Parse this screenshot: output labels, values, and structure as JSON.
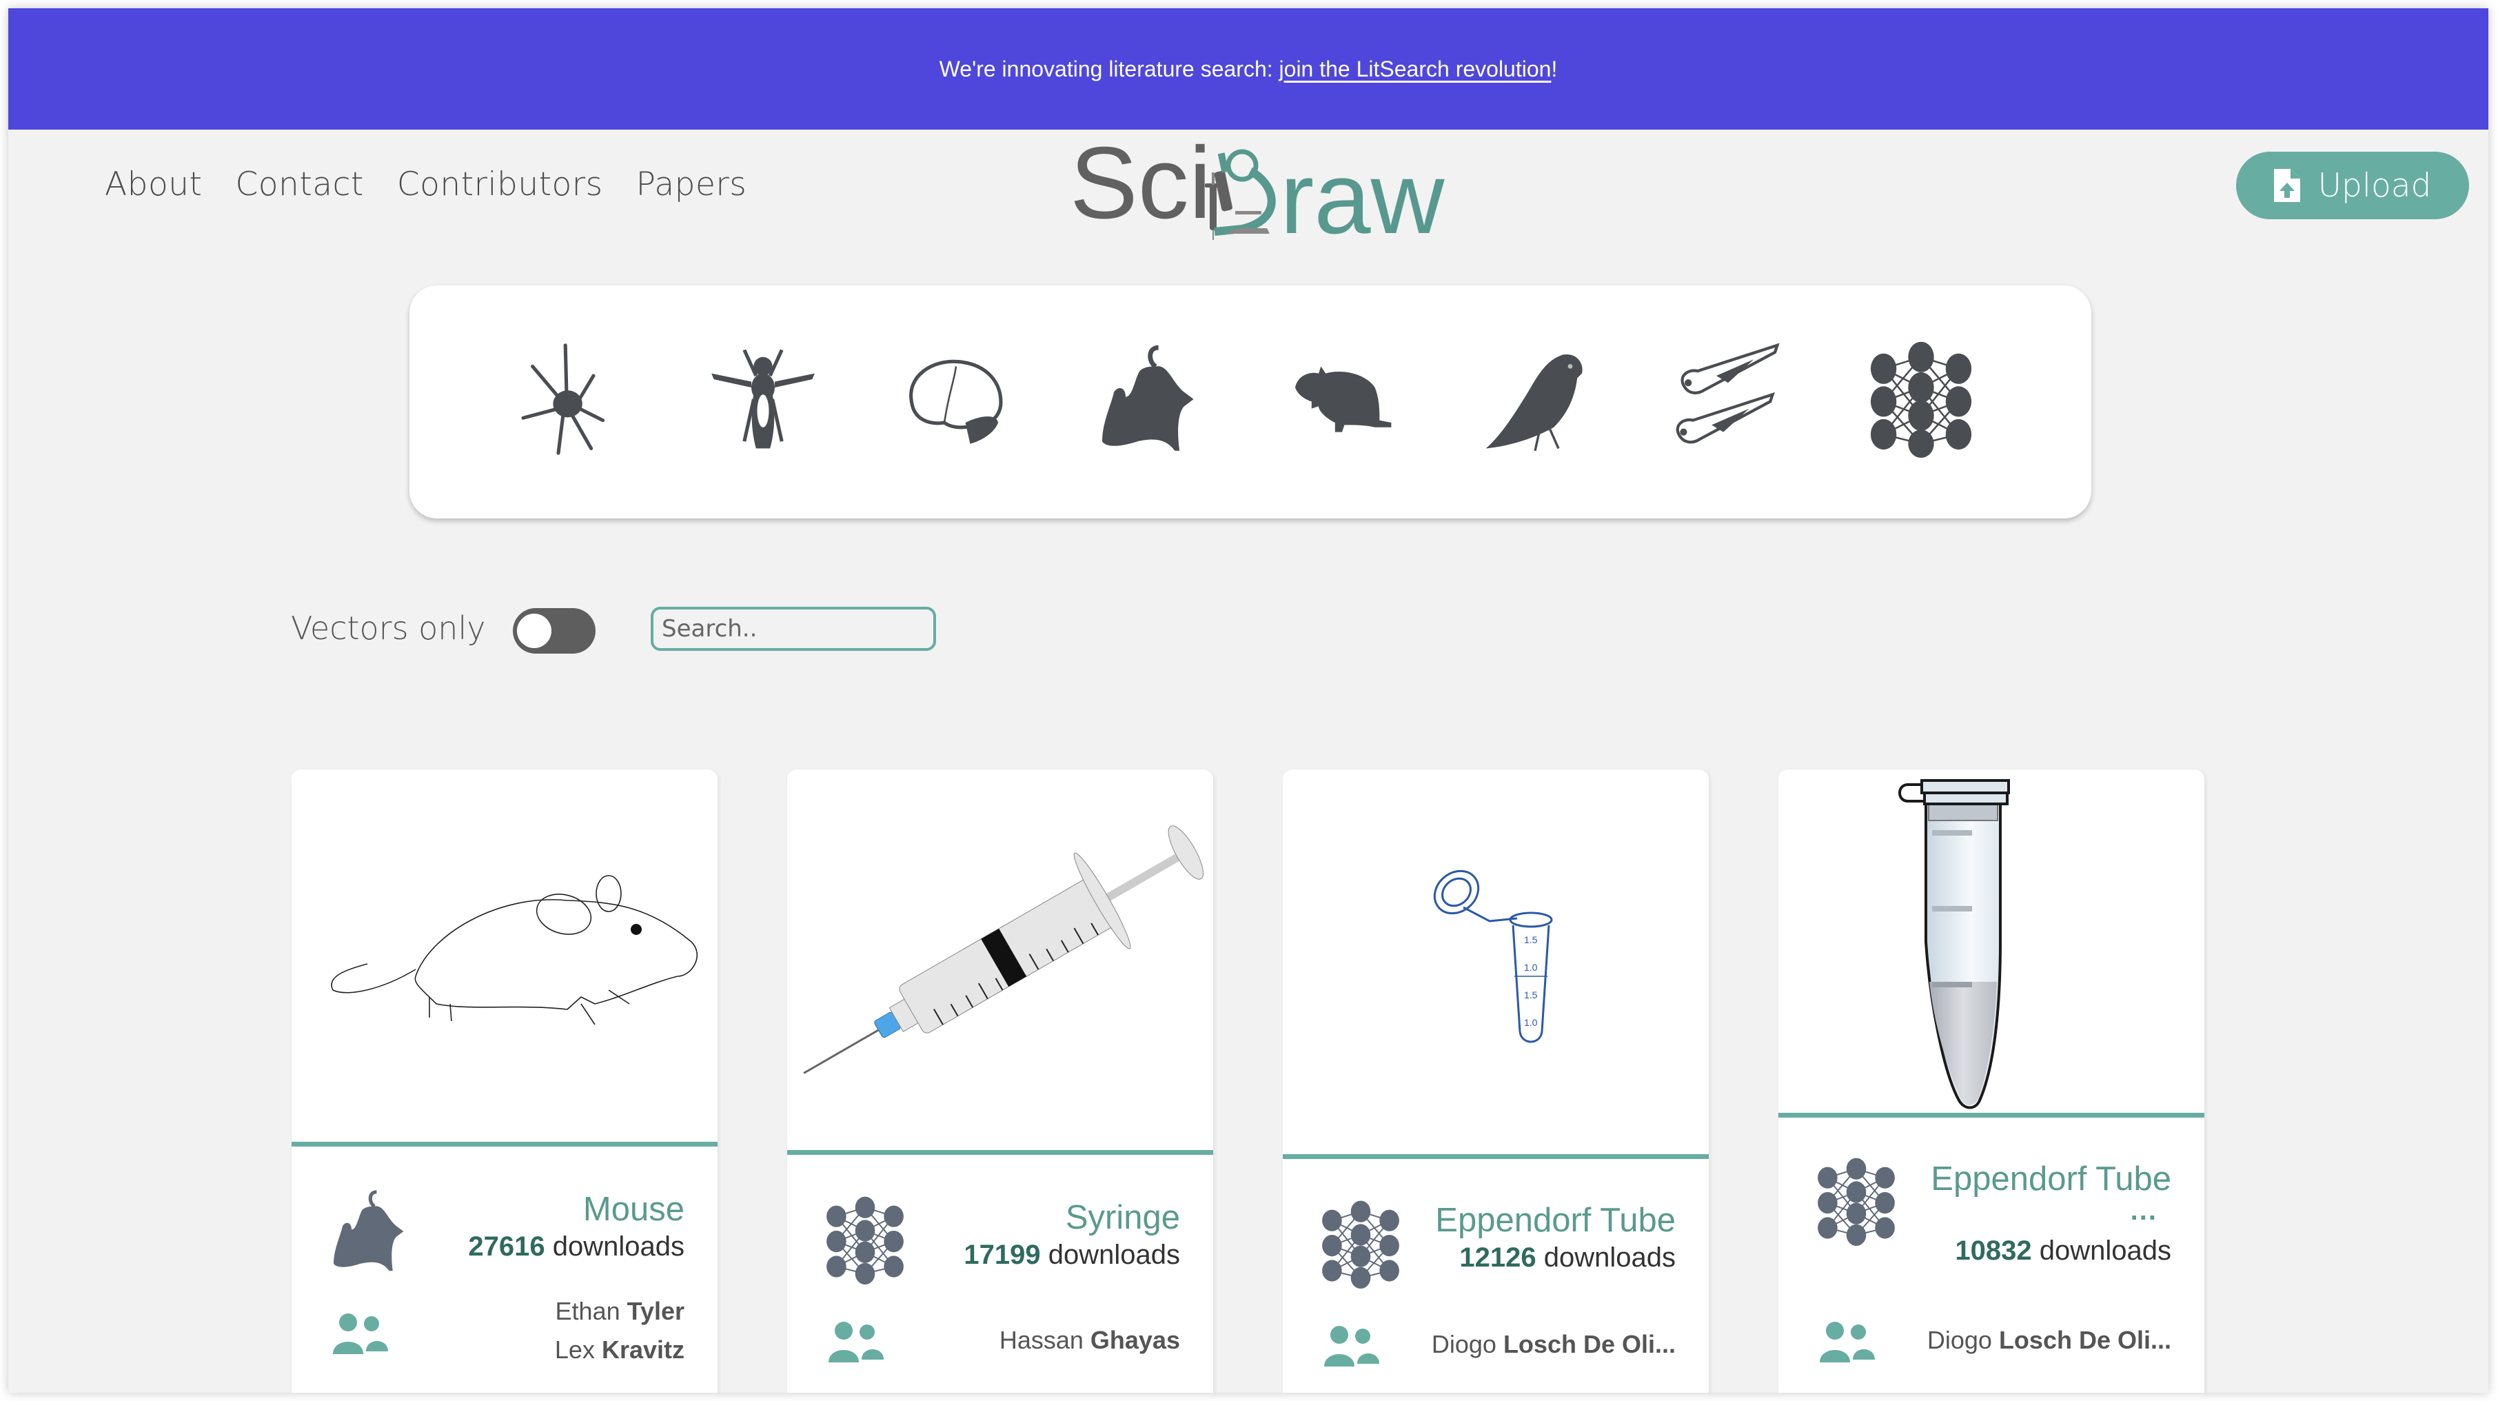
{
  "banner": {
    "text": "We're innovating literature search: ",
    "link_label": "join the LitSearch revolution",
    "suffix": "!"
  },
  "nav": {
    "items": [
      {
        "label": "About"
      },
      {
        "label": "Contact"
      },
      {
        "label": "Contributors"
      },
      {
        "label": "Papers"
      }
    ]
  },
  "logo": {
    "part1": "Sci",
    "part2": "raw",
    "alt": "SciDraw"
  },
  "upload_button": {
    "label": "Upload",
    "icon": "file-upload-icon"
  },
  "categories": [
    {
      "name": "neuron",
      "icon": "neuron-icon"
    },
    {
      "name": "fly",
      "icon": "fly-icon"
    },
    {
      "name": "brain",
      "icon": "brain-icon"
    },
    {
      "name": "mouse",
      "icon": "mouse-icon"
    },
    {
      "name": "rat",
      "icon": "rat-icon"
    },
    {
      "name": "bird",
      "icon": "bird-icon"
    },
    {
      "name": "zebrafish",
      "icon": "zebrafish-icon"
    },
    {
      "name": "neural-network",
      "icon": "neural-network-icon"
    }
  ],
  "filters": {
    "vectors_only_label": "Vectors only",
    "vectors_only_on": false,
    "search_placeholder": "Search..",
    "search_value": ""
  },
  "colors": {
    "banner": "#4f46dc",
    "accent": "#67ada2",
    "title": "#5a9a8e",
    "download_count": "#2f6a5f",
    "icon_gray": "#4a4d52"
  },
  "cards": [
    {
      "title": "Mouse",
      "title_overflow": "",
      "downloads": "27616",
      "downloads_label": "downloads",
      "category_icon": "mouse-icon",
      "authors": [
        {
          "first": "Ethan",
          "last": "Tyler"
        },
        {
          "first": "Lex",
          "last": "Kravitz"
        }
      ]
    },
    {
      "title": "Syringe",
      "title_overflow": "",
      "downloads": "17199",
      "downloads_label": "downloads",
      "category_icon": "neural-network-icon",
      "authors": [
        {
          "first": "Hassan",
          "last": "Ghayas"
        }
      ]
    },
    {
      "title": "Eppendorf Tube",
      "title_overflow": "",
      "downloads": "12126",
      "downloads_label": "downloads",
      "category_icon": "neural-network-icon",
      "authors": [
        {
          "first": "Diogo",
          "last": "Losch De Oli..."
        }
      ]
    },
    {
      "title": "Eppendorf Tube",
      "title_overflow": "...",
      "downloads": "10832",
      "downloads_label": "downloads",
      "category_icon": "neural-network-icon",
      "authors": [
        {
          "first": "Diogo",
          "last": "Losch De Oli..."
        }
      ]
    }
  ]
}
